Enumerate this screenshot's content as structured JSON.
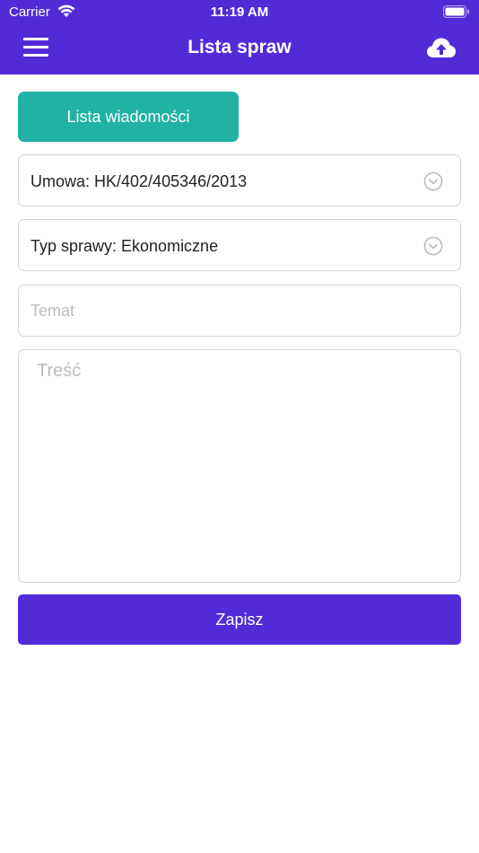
{
  "status_bar": {
    "carrier": "Carrier",
    "time": "11:19 AM"
  },
  "nav": {
    "title": "Lista spraw",
    "menu_icon": "hamburger-menu-icon",
    "action_icon": "cloud-upload-icon"
  },
  "form": {
    "messages_button_label": "Lista wiadomości",
    "contract_select": "Umowa: HK/402/405346/2013",
    "case_type_select": "Typ sprawy: Ekonomiczne",
    "subject_placeholder": "Temat",
    "subject_value": "",
    "content_placeholder": "Treść",
    "content_value": "",
    "save_label": "Zapisz"
  },
  "colors": {
    "primary": "#522bd6",
    "accent": "#21b2a6",
    "border": "#d6d6d6",
    "placeholder": "#bcbcbc"
  }
}
